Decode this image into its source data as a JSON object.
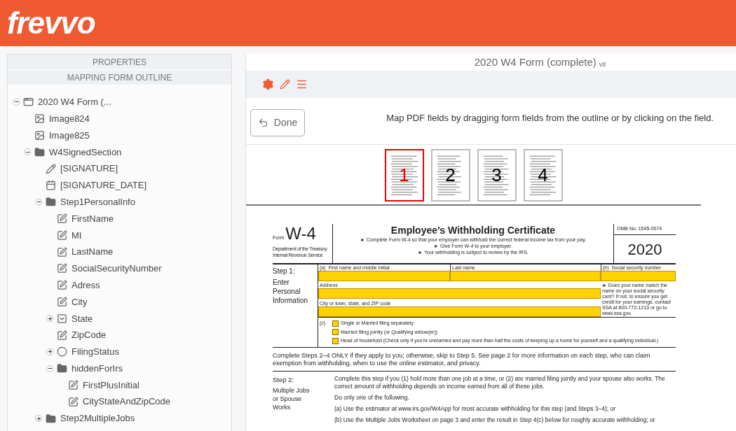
{
  "header": {
    "logo": "frevvo"
  },
  "sidebar": {
    "sections": [
      "PROPERTIES",
      "MAPPING FORM OUTLINE"
    ],
    "tree": [
      {
        "label": "2020 W4 Form (...",
        "kind": "form",
        "expanded": true,
        "children": [
          {
            "label": "Image824",
            "kind": "image"
          },
          {
            "label": "Image825",
            "kind": "image"
          },
          {
            "label": "W4SignedSection",
            "kind": "section",
            "expanded": true,
            "children": [
              {
                "label": "[SIGNATURE]",
                "kind": "signature"
              },
              {
                "label": "[SIGNATURE_DATE]",
                "kind": "date"
              },
              {
                "label": "Step1PersonalInfo",
                "kind": "section",
                "expanded": true,
                "children": [
                  {
                    "label": "FirstName",
                    "kind": "text"
                  },
                  {
                    "label": "MI",
                    "kind": "text"
                  },
                  {
                    "label": "LastName",
                    "kind": "text"
                  },
                  {
                    "label": "SocialSecurityNumber",
                    "kind": "text"
                  },
                  {
                    "label": "Adress",
                    "kind": "text"
                  },
                  {
                    "label": "City",
                    "kind": "text"
                  },
                  {
                    "label": "State",
                    "kind": "dropdown",
                    "expanded": false
                  },
                  {
                    "label": "ZipCode",
                    "kind": "text"
                  },
                  {
                    "label": "FilingStatus",
                    "kind": "radio",
                    "expanded": false
                  },
                  {
                    "label": "hiddenForIrs",
                    "kind": "section",
                    "expanded": true,
                    "children": [
                      {
                        "label": "FirstPlusInitial",
                        "kind": "text"
                      },
                      {
                        "label": "CityStateAndZipCode",
                        "kind": "text"
                      }
                    ]
                  }
                ]
              },
              {
                "label": "Step2MultipleJobs",
                "kind": "section",
                "expanded": false
              }
            ]
          }
        ]
      }
    ]
  },
  "main": {
    "title": "2020 W4 Form (complete)",
    "version": "v8",
    "done_button": "Done",
    "hint": "Map PDF fields by dragging form fields from the outline or by clicking on the field.",
    "pages": [
      {
        "label": "1",
        "selected": true
      },
      {
        "label": "2",
        "selected": false
      },
      {
        "label": "3",
        "selected": false
      },
      {
        "label": "4",
        "selected": false
      }
    ],
    "document": {
      "form_label": "Form",
      "form_number": "W-4",
      "department": [
        "Department of the Treasury",
        "Internal Revenue Service"
      ],
      "title": "Employee’s Withholding Certificate",
      "instructions": [
        "► Complete Form W-4 so that your employer can withhold the correct federal income tax from your pay.",
        "► Give Form W-4 to your employer.",
        "► Your withholding is subject to review by the IRS."
      ],
      "omb": "OMB No. 1545-0074",
      "year": "2020",
      "step1": {
        "heading": "Step 1:",
        "subheading": "Enter Personal Information",
        "first_name_label": "(a)  First name and middle initial",
        "last_name_label": "Last name",
        "ssn_label": "(b)  Social security number",
        "address_label": "Address",
        "city_label": "City or town, state, and ZIP code",
        "ssn_note": "► Does your name match the name on your social security card? If not, to ensure you get credit for your earnings, contact SSA at 800-772-1213 or go to www.ssa.gov.",
        "filing_label": "(c)",
        "filing_options": [
          {
            "label": "Single or Married filing separately",
            "checked": false
          },
          {
            "label": "Married filing jointly (or Qualifying widow(er))",
            "checked": false
          },
          {
            "label": "Head of household (Check only if you’re unmarried and pay more than half the costs of keeping up a home for yourself and a qualifying individual.)",
            "checked": false
          }
        ]
      },
      "notice": "Complete Steps 2–4 ONLY if they apply to you; otherwise, skip to Step 5. See page 2 for more information on each step, who can claim exemption from withholding, when to use the online estimator, and privacy.",
      "step2": {
        "heading": "Step 2:",
        "subheading": "Multiple Jobs or Spouse Works",
        "paragraphs": [
          "Complete this step if you (1) hold more than one job at a time, or (2) are married filing jointly and your spouse also works. The correct amount of withholding depends on income earned from all of these jobs.",
          "Do only one of the following.",
          "(a) Use the estimator at www.irs.gov/W4App for most accurate withholding for this step (and Steps 3–4); or",
          "(b) Use the Multiple Jobs Worksheet on page 3 and enter the result in Step 4(c) below for roughly accurate withholding; or"
        ]
      }
    }
  }
}
